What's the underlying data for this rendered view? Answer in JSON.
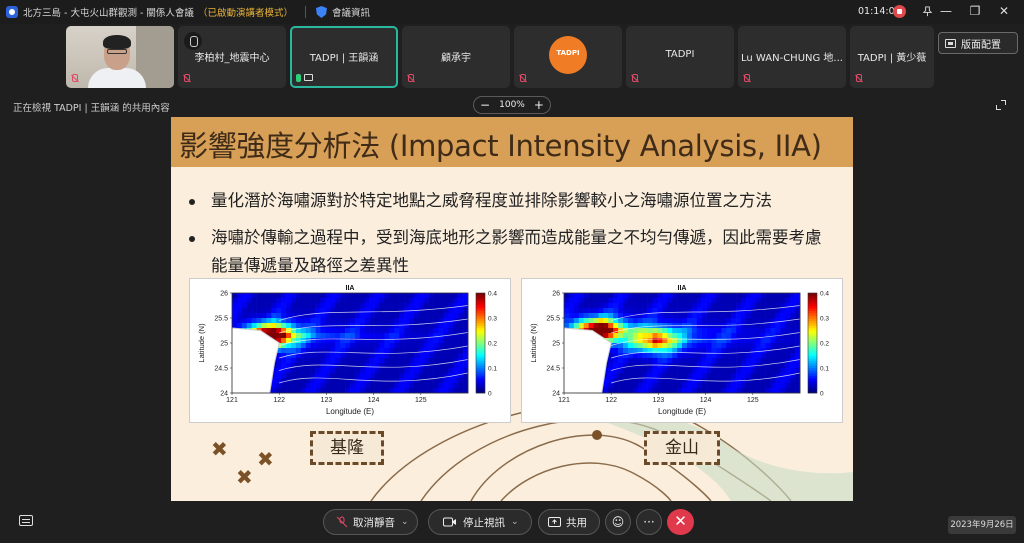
{
  "titlebar": {
    "title": "北方三島 - 大屯火山群觀測 - 關係人會議",
    "mode": "（已啟動演講者模式）",
    "info": "會議資訊",
    "time": "01:14:03"
  },
  "participants": [
    {
      "name": "",
      "mic": "off",
      "type": "video"
    },
    {
      "name": "李柏村_地震中心",
      "mic": "off",
      "type": "camera-off"
    },
    {
      "name": "TADPI | 王韻涵",
      "mic": "on",
      "type": "active"
    },
    {
      "name": "顧承宇",
      "mic": "off",
      "type": "plain"
    },
    {
      "name": "",
      "mic": "off",
      "type": "logo",
      "logo_text": "TADPI"
    },
    {
      "name": "TADPI",
      "mic": "off",
      "type": "plain"
    },
    {
      "name": "Lu WAN-CHUNG 地...",
      "mic": "off",
      "type": "plain"
    },
    {
      "name": "TADPI | 黃少薇",
      "mic": "off",
      "type": "plain"
    }
  ],
  "layout_button": "版面配置",
  "share_info": "正在檢視 TADPI | 王韻涵 的共用內容",
  "zoom": {
    "minus": "−",
    "level": "100%",
    "plus": "+"
  },
  "slide": {
    "title": "影響強度分析法 (Impact Intensity Analysis, IIA)",
    "bullet1": "量化潛於海嘯源對於特定地點之威脅程度並排除影響較小之海嘯源位置之方法",
    "bullet2": "海嘯於傳輸之過程中，受到海底地形之影響而造成能量之不均勻傳遞，因此需要考慮",
    "bullet2_cont": "能量傳遞量及路徑之差異性",
    "tag_left": "基隆",
    "tag_right": "金山"
  },
  "chart_data": [
    {
      "type": "heatmap",
      "title": "IIA",
      "xlabel": "Longitude (E)",
      "ylabel": "Latitude (N)",
      "xlim": [
        121,
        126
      ],
      "ylim": [
        24,
        26
      ],
      "xticks": [
        "121",
        "122",
        "123",
        "124",
        "125"
      ],
      "yticks": [
        "24",
        "24.5",
        "25",
        "25.5",
        "26"
      ],
      "colorbar": {
        "min": 0,
        "max": 0.4,
        "ticks": [
          "0",
          "0.1",
          "0.2",
          "0.3",
          "0.4"
        ]
      },
      "hotspots": [
        {
          "lon": 121.8,
          "lat": 25.15,
          "value": 0.4
        }
      ]
    },
    {
      "type": "heatmap",
      "title": "IIA",
      "xlabel": "Longitude (E)",
      "ylabel": "Latitude (N)",
      "xlim": [
        121,
        126
      ],
      "ylim": [
        24,
        26
      ],
      "xticks": [
        "121",
        "122",
        "123",
        "124",
        "125"
      ],
      "yticks": [
        "24",
        "24.5",
        "25",
        "25.5",
        "26"
      ],
      "colorbar": {
        "min": 0,
        "max": 0.4,
        "ticks": [
          "0",
          "0.1",
          "0.2",
          "0.3",
          "0.4"
        ]
      },
      "hotspots": [
        {
          "lon": 121.7,
          "lat": 25.25,
          "value": 0.4
        },
        {
          "lon": 122.9,
          "lat": 25.05,
          "value": 0.25
        }
      ]
    }
  ],
  "controls": {
    "unmute": "取消靜音",
    "stop_video": "停止視訊",
    "share": "共用",
    "more": "···",
    "hangup": "✕"
  },
  "date": "2023年9月26日"
}
